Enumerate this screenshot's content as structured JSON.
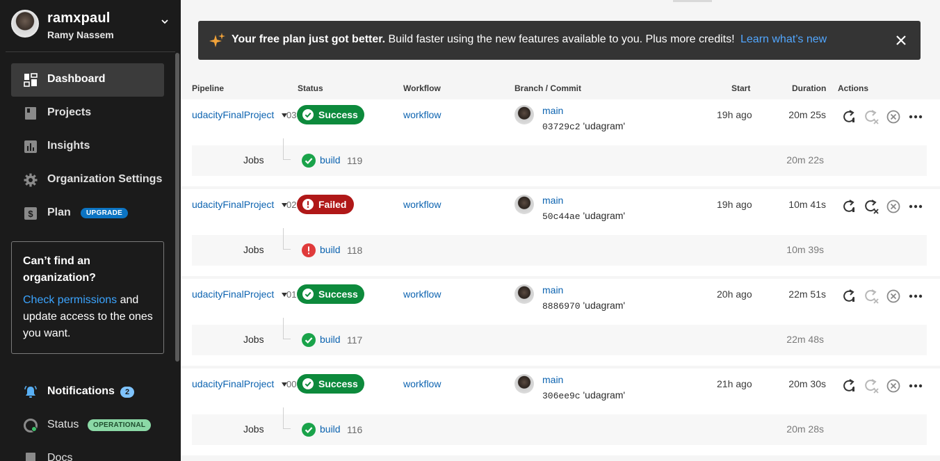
{
  "user": {
    "username": "ramxpaul",
    "full_name": "Ramy Nassem"
  },
  "sidebar": {
    "items": [
      {
        "label": "Dashboard",
        "icon": "dashboard-icon",
        "active": true
      },
      {
        "label": "Projects",
        "icon": "book-icon"
      },
      {
        "label": "Insights",
        "icon": "bar-chart-icon"
      },
      {
        "label": "Organization Settings",
        "icon": "gear-icon"
      },
      {
        "label": "Plan",
        "icon": "dollar-icon",
        "badge": "UPGRADE"
      }
    ],
    "find_org": {
      "title": "Can’t find an organization?",
      "link": "Check permissions",
      "text": " and update access to the ones you want."
    },
    "bottom": {
      "notifications": {
        "label": "Notifications",
        "count": "2"
      },
      "status": {
        "label": "Status",
        "badge": "OPERATIONAL"
      },
      "docs": {
        "label": "Docs"
      }
    }
  },
  "banner": {
    "bold": "Your free plan just got better.",
    "text": " Build faster using the new features available to you. Plus more credits! ",
    "link": "Learn what’s new"
  },
  "table": {
    "headers": {
      "pipeline": "Pipeline",
      "status": "Status",
      "workflow": "Workflow",
      "branch": "Branch / Commit",
      "start": "Start",
      "duration": "Duration",
      "actions": "Actions"
    },
    "rows": [
      {
        "project": "udacityFinalProject",
        "number": "03",
        "status": "Success",
        "workflow": "workflow",
        "branch": "main",
        "sha": "03729c2",
        "message": "'udagram'",
        "start": "19h ago",
        "duration": "20m 25s",
        "jobs_label": "Jobs",
        "job_name": "build",
        "job_number": "119",
        "job_status": "success",
        "job_duration": "20m 22s"
      },
      {
        "project": "udacityFinalProject",
        "number": "02",
        "status": "Failed",
        "workflow": "workflow",
        "branch": "main",
        "sha": "50c44ae",
        "message": "'udagram'",
        "start": "19h ago",
        "duration": "10m 41s",
        "jobs_label": "Jobs",
        "job_name": "build",
        "job_number": "118",
        "job_status": "failed",
        "job_duration": "10m 39s"
      },
      {
        "project": "udacityFinalProject",
        "number": "01",
        "status": "Success",
        "workflow": "workflow",
        "branch": "main",
        "sha": "8886970",
        "message": "'udagram'",
        "start": "20h ago",
        "duration": "22m 51s",
        "jobs_label": "Jobs",
        "job_name": "build",
        "job_number": "117",
        "job_status": "success",
        "job_duration": "22m 48s"
      },
      {
        "project": "udacityFinalProject",
        "number": "00",
        "status": "Success",
        "workflow": "workflow",
        "branch": "main",
        "sha": "306ee9c",
        "message": "'udagram'",
        "start": "21h ago",
        "duration": "20m 30s",
        "jobs_label": "Jobs",
        "job_name": "build",
        "job_number": "116",
        "job_status": "success",
        "job_duration": "20m 28s"
      }
    ]
  },
  "colors": {
    "success": "#0d8a3c",
    "failed": "#b01818",
    "link": "#0c63b0",
    "sidebar_bg": "#1b1b1b",
    "upgrade": "#0c74c3"
  }
}
